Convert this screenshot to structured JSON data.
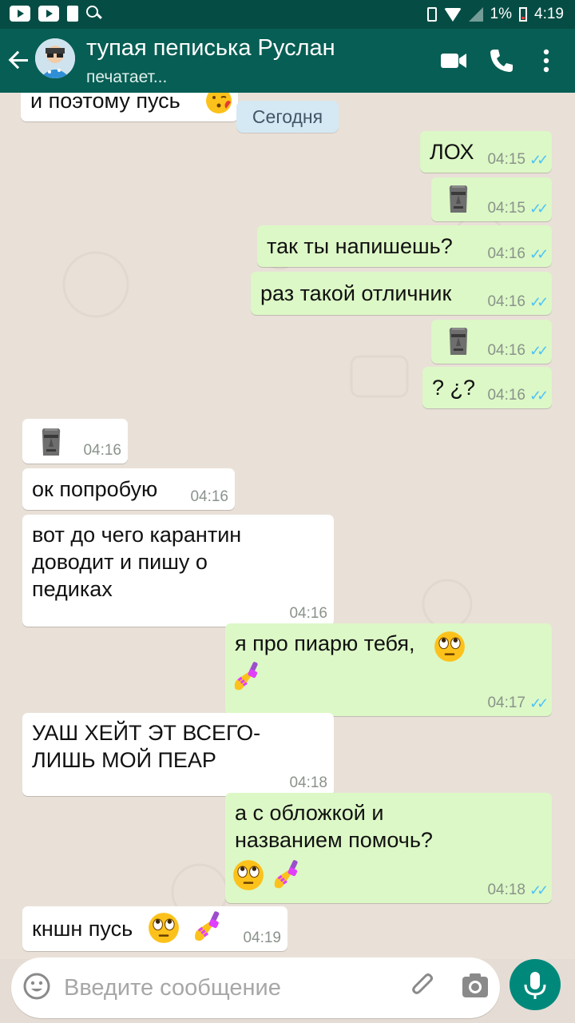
{
  "status_bar": {
    "battery_percent": "1%",
    "time": "4:19"
  },
  "header": {
    "contact_name": "тупая пеписька Руслан",
    "contact_status": "печатает..."
  },
  "chat": {
    "prev_message_text": "и поэтому пусь",
    "date_separator": "Сегодня",
    "messages": [
      {
        "dir": "out",
        "text": "ЛОХ",
        "time": "04:15",
        "emoji": []
      },
      {
        "dir": "out",
        "text": "",
        "time": "04:15",
        "emoji": [
          "moai"
        ]
      },
      {
        "dir": "out",
        "text": "так ты напишешь?",
        "time": "04:16",
        "emoji": []
      },
      {
        "dir": "out",
        "text": "раз такой отличник",
        "time": "04:16",
        "emoji": []
      },
      {
        "dir": "out",
        "text": "",
        "time": "04:16",
        "emoji": [
          "moai"
        ]
      },
      {
        "dir": "out",
        "text": "? ¿?",
        "time": "04:16",
        "emoji": []
      },
      {
        "dir": "in",
        "text": "",
        "time": "04:16",
        "emoji": [
          "moai"
        ]
      },
      {
        "dir": "in",
        "text": "ок попробую",
        "time": "04:16",
        "emoji": []
      },
      {
        "dir": "in",
        "text": "вот до чего карантин\nдоводит и пишу о\nпедиках",
        "time": "04:16",
        "emoji": []
      },
      {
        "dir": "out",
        "text": "я про пиарю тебя,",
        "time": "04:17",
        "emoji": [
          "eye-roll",
          "nail-polish"
        ]
      },
      {
        "dir": "in",
        "text": "УАШ ХЕЙТ ЭТ ВСЕГО-\nЛИШЬ МОЙ ПЕАР",
        "time": "04:18",
        "emoji": []
      },
      {
        "dir": "out",
        "text": "а с обложкой и\nназванием помочь?",
        "time": "04:18",
        "emoji": [
          "eye-roll",
          "nail-polish"
        ]
      },
      {
        "dir": "in",
        "text": "кншн пусь",
        "time": "04:19",
        "emoji": [
          "eye-roll",
          "nail-polish"
        ]
      }
    ]
  },
  "composer": {
    "placeholder": "Введите сообщение"
  },
  "colors": {
    "header": "#075e54",
    "status_bar": "#054d44",
    "outgoing_bubble": "#dcf8c6",
    "incoming_bubble": "#ffffff",
    "read_ticks": "#4fc3f7",
    "mic_button": "#00897b"
  },
  "icons": [
    "youtube-icon",
    "youtube-icon",
    "bag-icon",
    "search-icon",
    "vibrate-icon",
    "wifi-icon",
    "signal-icon",
    "battery-icon",
    "back-arrow-icon",
    "video-call-icon",
    "phone-icon",
    "more-vert-icon",
    "emoji-icon",
    "attach-icon",
    "camera-icon",
    "mic-icon"
  ]
}
